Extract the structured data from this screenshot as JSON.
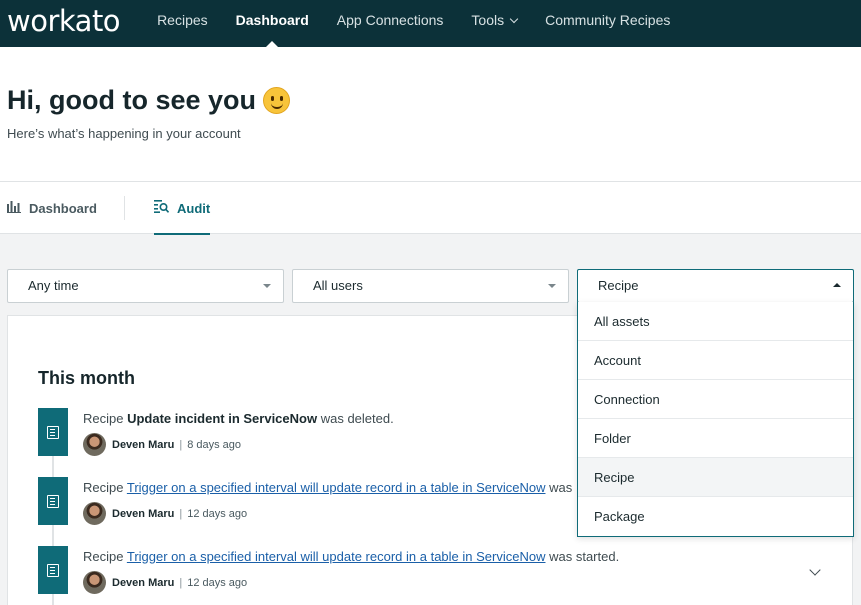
{
  "nav": {
    "logo": "workato",
    "items": [
      {
        "label": "Recipes"
      },
      {
        "label": "Dashboard",
        "active": true
      },
      {
        "label": "App Connections"
      },
      {
        "label": "Tools",
        "has_dropdown": true
      },
      {
        "label": "Community Recipes"
      }
    ]
  },
  "header": {
    "greeting": "Hi, good to see you",
    "greeting_emoji": "smile-emoji",
    "subtitle": "Here’s what’s happening in your account"
  },
  "tabs": [
    {
      "label": "Dashboard",
      "icon": "bar-chart-icon",
      "active": false
    },
    {
      "label": "Audit",
      "icon": "audit-list-icon",
      "active": true
    }
  ],
  "filters": {
    "time": "Any time",
    "users": "All users",
    "asset": "Recipe"
  },
  "asset_dropdown": {
    "open": true,
    "options": [
      "All assets",
      "Account",
      "Connection",
      "Folder",
      "Recipe",
      "Package"
    ],
    "selected": "Recipe"
  },
  "activity": {
    "period_heading": "This month",
    "entries": [
      {
        "prefix": "Recipe",
        "name": "Update incident in ServiceNow",
        "name_style": "bold",
        "suffix": "was deleted.",
        "user": "Deven Maru",
        "time": "8 days ago"
      },
      {
        "prefix": "Recipe",
        "name": "Trigger on a specified interval will update record in a table in ServiceNow",
        "name_style": "link",
        "suffix": "was",
        "user": "Deven Maru",
        "time": "12 days ago"
      },
      {
        "prefix": "Recipe",
        "name": "Trigger on a specified interval will update record in a table in ServiceNow",
        "name_style": "link",
        "suffix": "was started.",
        "user": "Deven Maru",
        "time": "12 days ago"
      }
    ]
  },
  "colors": {
    "nav_bg": "#0c3139",
    "accent": "#0f6b78",
    "link": "#1a5fa8"
  }
}
